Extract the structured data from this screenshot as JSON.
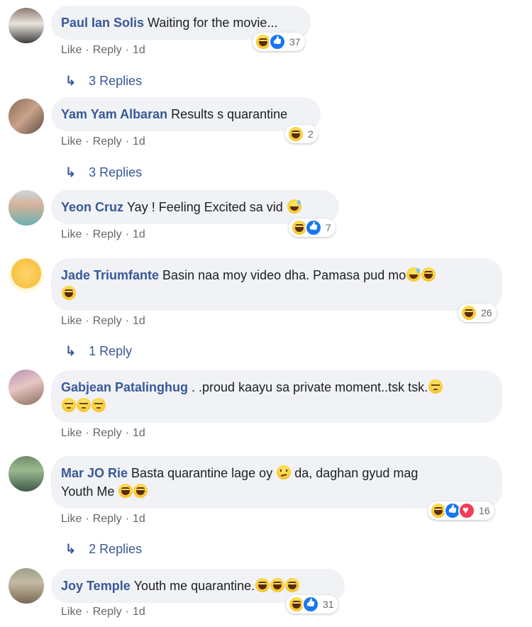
{
  "comments": [
    {
      "author": "Paul Ian Solis",
      "text": "Waiting for the movie...",
      "reaction_count": "37",
      "reactions": [
        "haha-icon",
        "like-icon"
      ],
      "actions": {
        "like": "Like",
        "reply": "Reply",
        "time": "1d"
      },
      "replies": "3 Replies"
    },
    {
      "author": "Yam Yam Albaran",
      "text": "Results s quarantine",
      "reaction_count": "2",
      "reactions": [
        "haha-icon"
      ],
      "actions": {
        "like": "Like",
        "reply": "Reply",
        "time": "1d"
      },
      "replies": "3 Replies"
    },
    {
      "author": "Yeon Cruz",
      "text": "Yay ! Feeling Excited sa vid",
      "reaction_count": "7",
      "reactions": [
        "haha-icon",
        "like-icon"
      ],
      "actions": {
        "like": "Like",
        "reply": "Reply",
        "time": "1d"
      }
    },
    {
      "author": "Jade Triumfante",
      "text": "Basin naa moy video dha. Pamasa pud mo",
      "reaction_count": "26",
      "reactions": [
        "haha-icon"
      ],
      "actions": {
        "like": "Like",
        "reply": "Reply",
        "time": "1d"
      },
      "replies": "1 Reply"
    },
    {
      "author": "Gabjean Patalinghug",
      "text": ". .proud kaayu sa private moment..tsk tsk.",
      "actions": {
        "like": "Like",
        "reply": "Reply",
        "time": "1d"
      }
    },
    {
      "author": "Mar JO Rie",
      "text_a": "Basta quarantine lage oy",
      "text_b": "da, daghan gyud mag",
      "text_c": "Youth Me",
      "reaction_count": "16",
      "reactions": [
        "haha-icon",
        "like-icon",
        "love-icon"
      ],
      "actions": {
        "like": "Like",
        "reply": "Reply",
        "time": "1d"
      },
      "replies": "2 Replies"
    },
    {
      "author": "Joy Temple",
      "text": "Youth me quarantine.",
      "reaction_count": "31",
      "reactions": [
        "haha-icon",
        "like-icon"
      ],
      "actions": {
        "like": "Like",
        "reply": "Reply",
        "time": "1d"
      }
    }
  ],
  "separator": "·",
  "colors": {
    "author": "#385898",
    "bubble": "#f0f2f5",
    "meta": "#65676b",
    "like": "#1877f2",
    "love": "#f33e58",
    "haha": "#f5b91c"
  }
}
